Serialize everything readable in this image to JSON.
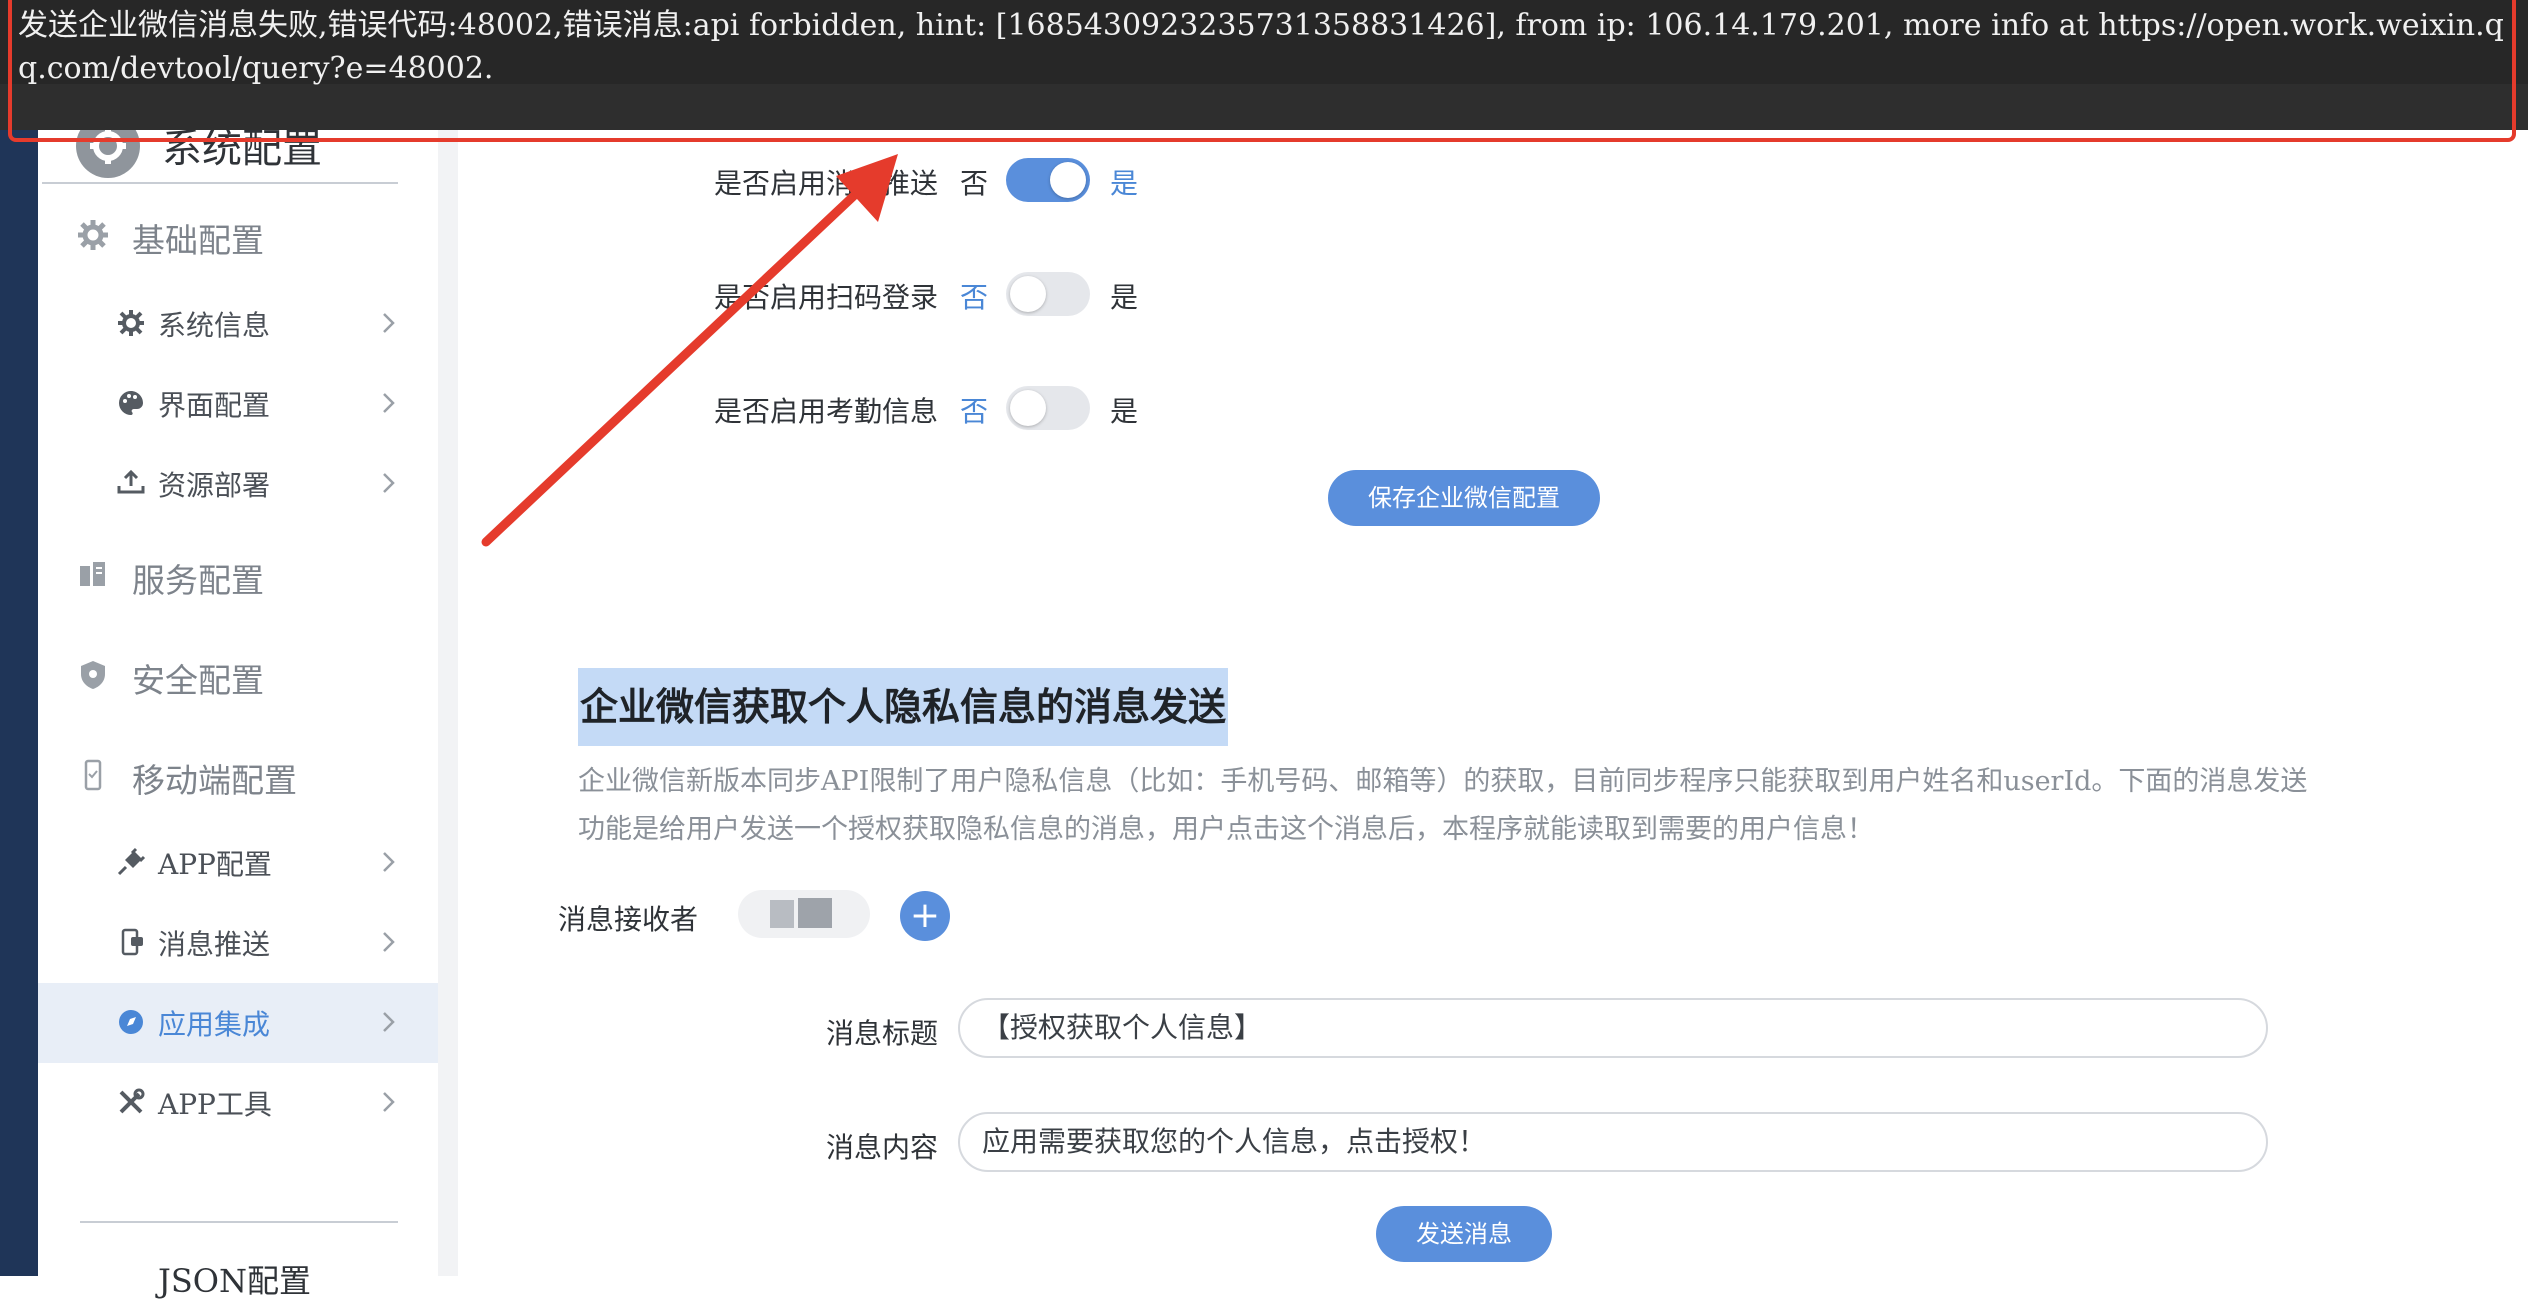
{
  "error_toast": {
    "message": "发送企业微信消息失败,错误代码:48002,错误消息:api forbidden, hint: [1685430923235731358831426], from ip: 106.14.179.201, more info at https://open.work.weixin.qq.com/devtool/query?e=48002."
  },
  "sidebar": {
    "header_title": "系统配置",
    "groups": [
      {
        "label": "基础配置",
        "icon": "gear-icon"
      },
      {
        "label": "服务配置",
        "icon": "server-icon"
      },
      {
        "label": "安全配置",
        "icon": "shield-icon"
      },
      {
        "label": "移动端配置",
        "icon": "mobile-icon"
      }
    ],
    "items": [
      {
        "label": "系统信息",
        "icon": "gear-icon"
      },
      {
        "label": "界面配置",
        "icon": "palette-icon"
      },
      {
        "label": "资源部署",
        "icon": "upload-icon"
      },
      {
        "label": "APP配置",
        "icon": "plug-icon"
      },
      {
        "label": "消息推送",
        "icon": "message-phone-icon"
      },
      {
        "label": "应用集成",
        "icon": "compass-icon",
        "active": true
      },
      {
        "label": "APP工具",
        "icon": "tools-icon"
      }
    ],
    "footer_label": "JSON配置"
  },
  "settings": [
    {
      "label": "是否启用消息推送",
      "off_label": "否",
      "on_label": "是",
      "enabled": true
    },
    {
      "label": "是否启用扫码登录",
      "off_label": "否",
      "on_label": "是",
      "enabled": false
    },
    {
      "label": "是否启用考勤信息",
      "off_label": "否",
      "on_label": "是",
      "enabled": false
    }
  ],
  "save_button": "保存企业微信配置",
  "privacy_section": {
    "title": "企业微信获取个人隐私信息的消息发送",
    "description": "企业微信新版本同步API限制了用户隐私信息（比如：手机号码、邮箱等）的获取，目前同步程序只能获取到用户姓名和userId。下面的消息发送功能是给用户发送一个授权获取隐私信息的消息，用户点击这个消息后，本程序就能读取到需要的用户信息！",
    "receiver_label": "消息接收者",
    "add_label": "+",
    "title_field_label": "消息标题",
    "title_field_value": "【授权获取个人信息】",
    "content_field_label": "消息内容",
    "content_field_value": "应用需要获取您的个人信息，点击授权！",
    "send_button": "发送消息"
  },
  "colors": {
    "accent": "#5a8fdc",
    "error_border": "#e53b2c",
    "highlight": "#c4daf6"
  }
}
